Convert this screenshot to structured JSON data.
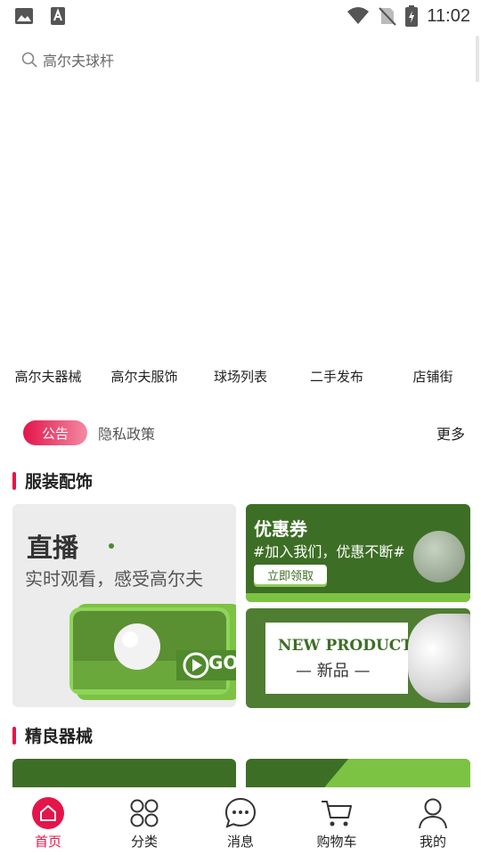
{
  "status_bar": {
    "time": "11:02"
  },
  "search": {
    "placeholder": "高尔夫球杆"
  },
  "categories": [
    {
      "label": "高尔夫器械"
    },
    {
      "label": "高尔夫服饰"
    },
    {
      "label": "球场列表"
    },
    {
      "label": "二手发布"
    },
    {
      "label": "店铺街"
    }
  ],
  "notice": {
    "badge": "公告",
    "text": "隐私政策",
    "more": "更多"
  },
  "sections": {
    "apparel": {
      "title": "服装配饰"
    },
    "equipment": {
      "title": "精良器械"
    }
  },
  "cards": {
    "live": {
      "title": "直播",
      "subtitle": "实时观看，感受高尔夫",
      "go_label": "GO"
    },
    "coupon": {
      "title": "优惠券",
      "subtitle": "#加入我们，优惠不断#",
      "button": "立即领取"
    },
    "new_product": {
      "title_en": "NEW PRODUCT",
      "title_cn": "— 新品 —"
    }
  },
  "tabbar": [
    {
      "label": "首页",
      "icon": "home-icon",
      "active": true
    },
    {
      "label": "分类",
      "icon": "grid-icon",
      "active": false
    },
    {
      "label": "消息",
      "icon": "chat-icon",
      "active": false
    },
    {
      "label": "购物车",
      "icon": "cart-icon",
      "active": false
    },
    {
      "label": "我的",
      "icon": "user-icon",
      "active": false
    }
  ],
  "colors": {
    "accent": "#e3154a",
    "green_dark": "#3d6e25",
    "green_light": "#7cc243"
  }
}
